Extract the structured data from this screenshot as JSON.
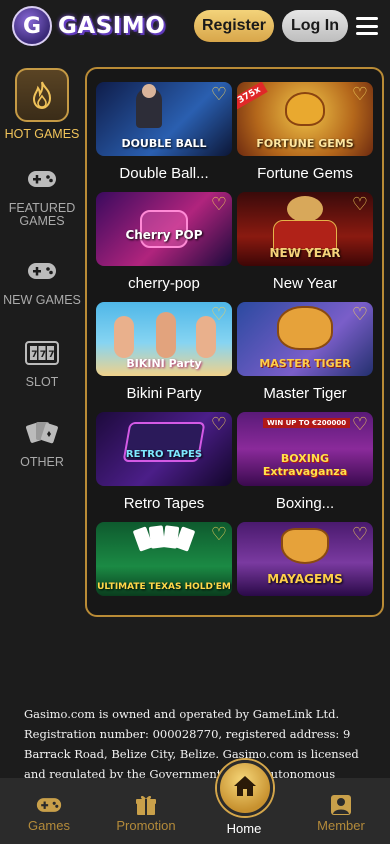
{
  "header": {
    "logo_mark": "G",
    "logo_badge": "GASINO",
    "logo_text": "GASIMO",
    "register_label": "Register",
    "login_label": "Log In"
  },
  "sidebar": {
    "items": [
      {
        "label": "HOT GAMES",
        "icon": "flame-icon",
        "active": true
      },
      {
        "label": "FEATURED GAMES",
        "icon": "gamepad-icon",
        "active": false
      },
      {
        "label": "NEW GAMES",
        "icon": "gamepad-icon",
        "active": false
      },
      {
        "label": "SLOT",
        "icon": "slot-machine-icon",
        "active": false
      },
      {
        "label": "OTHER",
        "icon": "cards-icon",
        "active": false
      }
    ]
  },
  "games": [
    {
      "name": "Double Ball...",
      "art_text": "DOUBLE BALL",
      "favorite": false
    },
    {
      "name": "Fortune Gems",
      "art_text": "FORTUNE GEMS",
      "badge": "375x",
      "favorite": false
    },
    {
      "name": "cherry-pop",
      "art_text": "Cherry POP",
      "favorite": false
    },
    {
      "name": "New Year",
      "art_text": "NEW YEAR",
      "favorite": false
    },
    {
      "name": "Bikini Party",
      "art_text": "BIKINI Party",
      "favorite": false
    },
    {
      "name": "Master Tiger",
      "art_text": "MASTER TIGER",
      "favorite": false
    },
    {
      "name": "Retro Tapes",
      "art_text": "RETRO TAPES",
      "favorite": false
    },
    {
      "name": "Boxing...",
      "art_text": "BOXING Extravaganza",
      "art_subtext": "WIN UP TO €200000",
      "favorite": false
    },
    {
      "name": "Ultimate Texas Hold'em",
      "art_text": "ULTIMATE TEXAS HOLD'EM",
      "favorite": false
    },
    {
      "name": "Maya Gems",
      "art_text": "MAYAGEMS",
      "favorite": false
    }
  ],
  "legal": {
    "text": "Gasimo.com is owned and operated by GameLink Ltd. Registration number: 000028770, registered address: 9 Barrack Road, Belize City, Belize. Gasimo.com is licensed and regulated by the Government of the Autonomous Island of"
  },
  "bottom_nav": {
    "items": [
      {
        "label": "Games",
        "icon": "gamepad-icon"
      },
      {
        "label": "Promotion",
        "icon": "gift-icon"
      },
      {
        "label": "Home",
        "icon": "home-icon",
        "active": true
      },
      {
        "label": "Member",
        "icon": "member-icon"
      }
    ]
  },
  "colors": {
    "background": "#1c1c1c",
    "accent_gold": "#f0c35a",
    "panel_border": "#b98b36",
    "nav_bar": "#2b2b2b"
  }
}
